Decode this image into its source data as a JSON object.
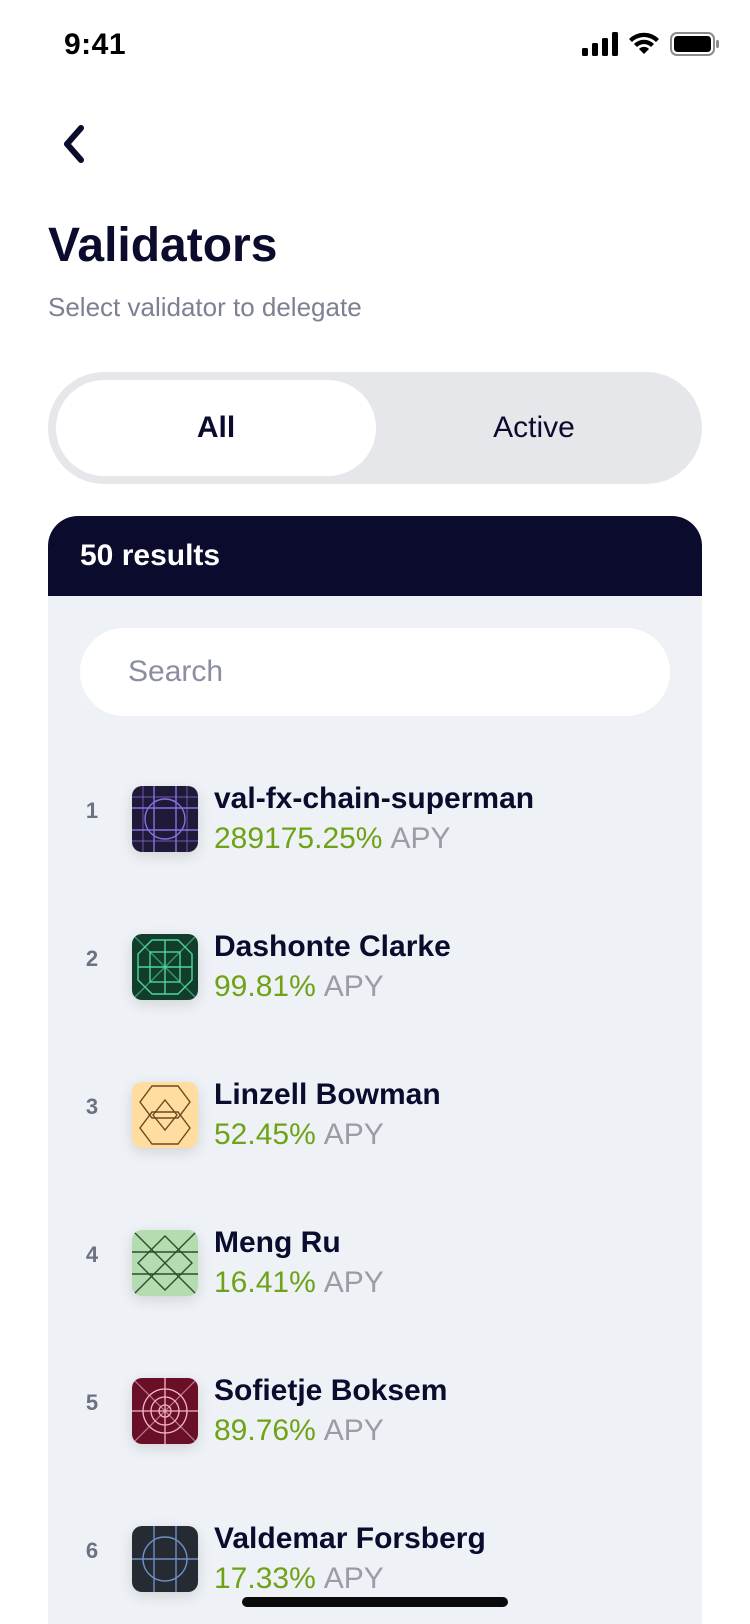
{
  "status": {
    "time": "9:41"
  },
  "header": {
    "title": "Validators",
    "subtitle": "Select validator to delegate"
  },
  "filter": {
    "options": [
      "All",
      "Active"
    ],
    "selected": "All"
  },
  "results": {
    "count_label": "50 results",
    "search_placeholder": "Search"
  },
  "validators": [
    {
      "rank": "1",
      "name": "val-fx-chain-superman",
      "apy": "289175.25%",
      "apy_label": "APY",
      "avatar": "grid-circle-purple"
    },
    {
      "rank": "2",
      "name": "Dashonte Clarke",
      "apy": "99.81%",
      "apy_label": "APY",
      "avatar": "octagon-green"
    },
    {
      "rank": "3",
      "name": "Linzell Bowman",
      "apy": "52.45%",
      "apy_label": "APY",
      "avatar": "hexagon-peach"
    },
    {
      "rank": "4",
      "name": "Meng Ru",
      "apy": "16.41%",
      "apy_label": "APY",
      "avatar": "diamond-lightgreen"
    },
    {
      "rank": "5",
      "name": "Sofietje Boksem",
      "apy": "89.76%",
      "apy_label": "APY",
      "avatar": "target-maroon"
    },
    {
      "rank": "6",
      "name": "Valdemar Forsberg",
      "apy": "17.33%",
      "apy_label": "APY",
      "avatar": "circle-slate"
    }
  ],
  "colors": {
    "navy": "#0b0b2e",
    "apy_green": "#6ea317",
    "muted": "#9a9ca6",
    "card_bg": "#eef1f5"
  }
}
